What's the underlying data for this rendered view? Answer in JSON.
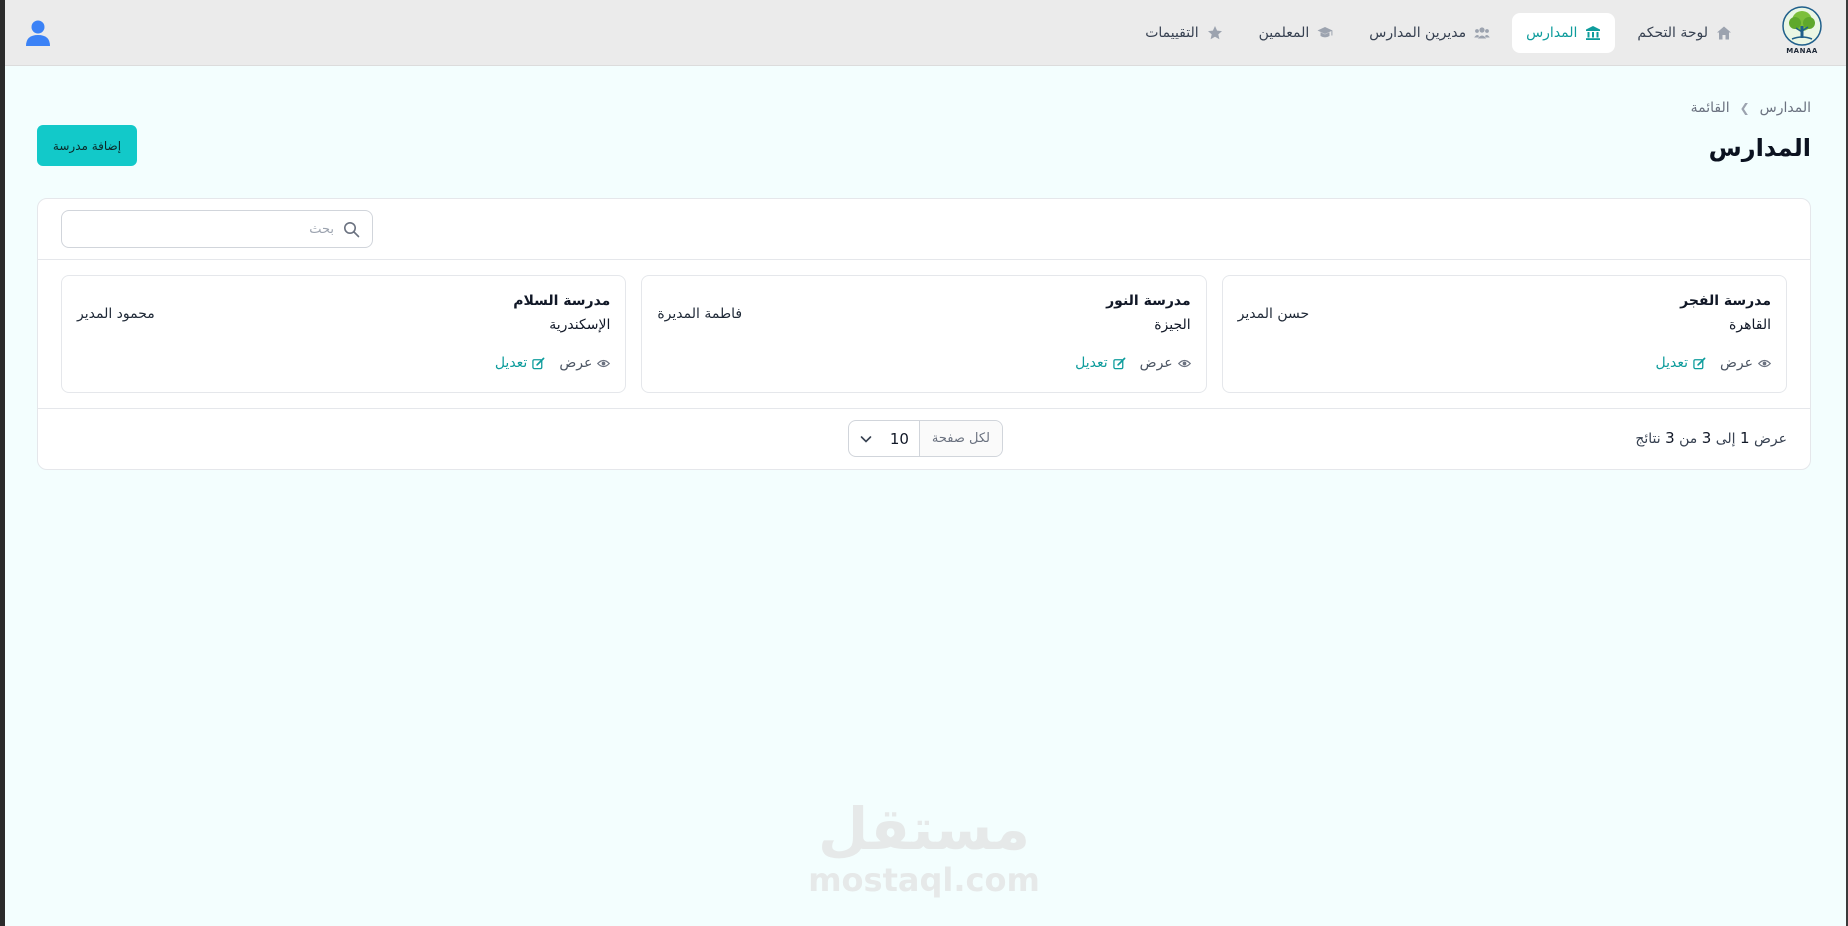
{
  "header": {
    "logo_text": "MANAA",
    "nav": [
      {
        "label": "لوحة التحكم",
        "icon": "home-icon",
        "active": false
      },
      {
        "label": "المدارس",
        "icon": "school-icon",
        "active": true
      },
      {
        "label": "مديرين المدارس",
        "icon": "users-icon",
        "active": false
      },
      {
        "label": "المعلمين",
        "icon": "graduation-cap-icon",
        "active": false
      },
      {
        "label": "التقييمات",
        "icon": "star-icon",
        "active": false
      }
    ]
  },
  "breadcrumb": {
    "items": [
      "المدارس",
      "القائمة"
    ]
  },
  "page": {
    "title": "المدارس",
    "add_button": "إضافة مدرسة"
  },
  "search": {
    "placeholder": "بحث",
    "value": ""
  },
  "schools": [
    {
      "name": "مدرسة الفجر",
      "city": "القاهرة",
      "manager": "حسن المدير",
      "view_label": "عرض",
      "edit_label": "تعديل"
    },
    {
      "name": "مدرسة النور",
      "city": "الجيزة",
      "manager": "فاطمة المديرة",
      "view_label": "عرض",
      "edit_label": "تعديل"
    },
    {
      "name": "مدرسة السلام",
      "city": "الإسكندرية",
      "manager": "محمود المدير",
      "view_label": "عرض",
      "edit_label": "تعديل"
    }
  ],
  "pagination": {
    "prefix": "عرض",
    "from": "1",
    "to_word": "إلى",
    "to": "3",
    "of_word": "من",
    "total": "3",
    "suffix": "نتائج",
    "per_page_label": "لكل صفحة",
    "per_page_value": "10"
  },
  "watermark": {
    "arabic": "مستقل",
    "english": "mostaql.com"
  },
  "colors": {
    "accent": "#0e9c9c",
    "button": "#12c9c9",
    "background": "#f3fefe"
  }
}
